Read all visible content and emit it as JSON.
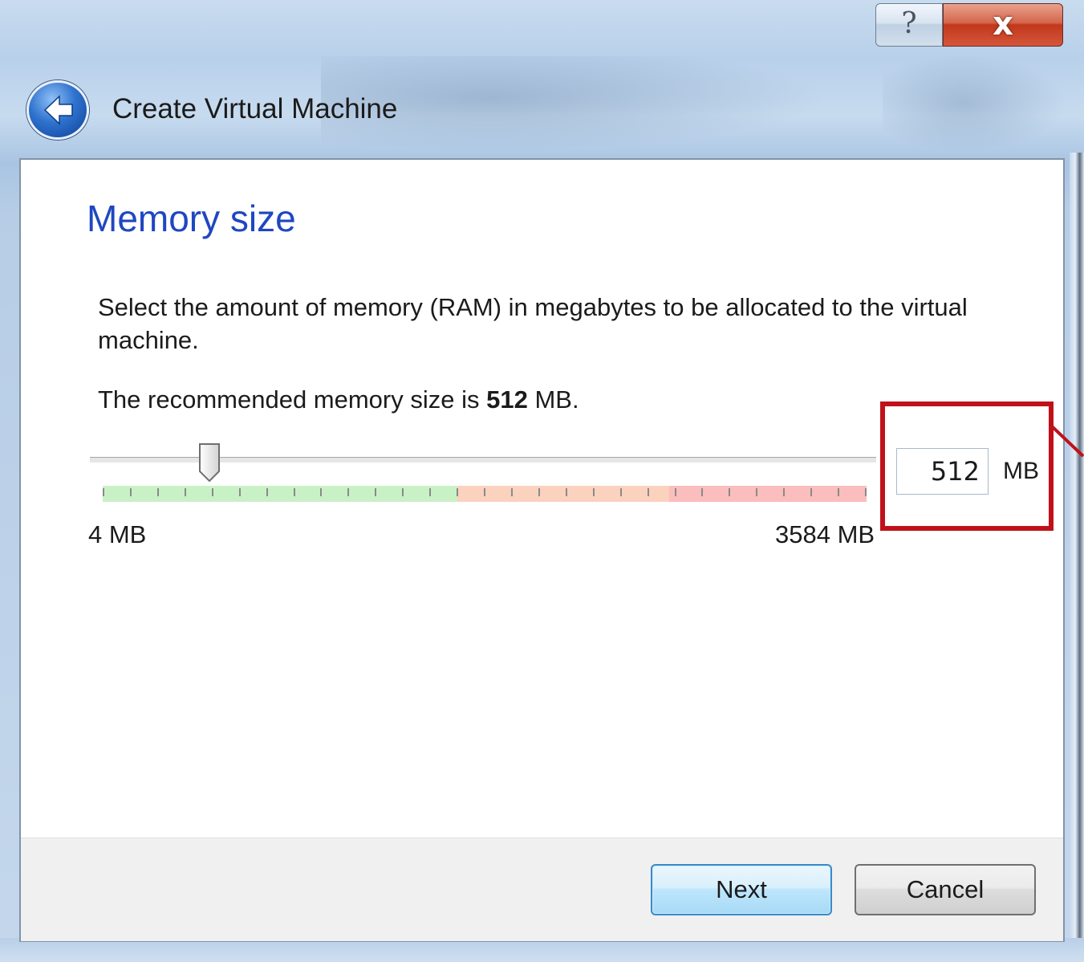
{
  "window": {
    "title": "Create Virtual Machine",
    "help_label": "?",
    "close_label": "x"
  },
  "page": {
    "heading": "Memory size",
    "description": "Select the amount of memory (RAM) in megabytes to be allocated to the virtual machine.",
    "recommend_prefix": "The recommended memory size is ",
    "recommend_value": "512",
    "recommend_suffix": " MB."
  },
  "memory": {
    "value": "512",
    "unit": "MB",
    "min_label": "4 MB",
    "max_label": "3584 MB",
    "min_mb": 4,
    "max_mb": 3584,
    "current_mb": 512
  },
  "buttons": {
    "next_label": "Next",
    "cancel_label": "Cancel"
  },
  "colors": {
    "heading": "#1f47c2",
    "highlight": "#c0111b",
    "scale_green": "#c8f2c6",
    "scale_orange": "#fbd2bd",
    "scale_red": "#fbbdbd"
  }
}
